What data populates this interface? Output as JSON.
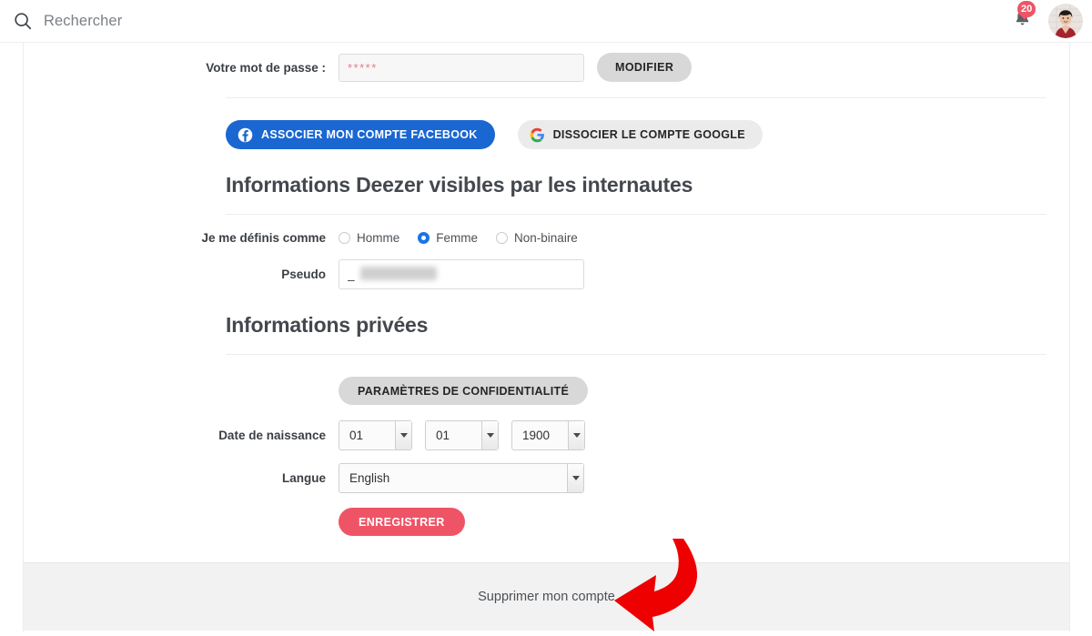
{
  "header": {
    "search": {
      "icon": "search-icon",
      "placeholder": "Rechercher",
      "value": ""
    },
    "notifications": {
      "icon": "bell-icon",
      "count": "20"
    },
    "avatar": {
      "icon": "avatar"
    }
  },
  "account": {
    "password": {
      "label": "Votre mot de passe :",
      "value": "*****",
      "modify_button": "MODIFIER"
    },
    "social": {
      "facebook_button": "ASSOCIER MON COMPTE FACEBOOK",
      "facebook_icon": "facebook-icon",
      "facebook_color": "#1a67d2",
      "google_button": "DISSOCIER LE COMPTE GOOGLE",
      "google_icon": "google-icon",
      "google_color": "#ebebeb"
    }
  },
  "public_info": {
    "title": "Informations Deezer visibles par les internautes",
    "gender": {
      "label": "Je me définis comme",
      "options": [
        {
          "label": "Homme",
          "selected": false
        },
        {
          "label": "Femme",
          "selected": true
        },
        {
          "label": "Non-binaire",
          "selected": false
        }
      ],
      "selected_color": "#1a73e8"
    },
    "pseudo": {
      "label": "Pseudo",
      "value": "_",
      "redacted": true
    }
  },
  "private_info": {
    "title": "Informations privées",
    "privacy_button": "PARAMÈTRES DE CONFIDENTIALITÉ",
    "birthdate": {
      "label": "Date de naissance",
      "day": "01",
      "month": "01",
      "year": "1900"
    },
    "language": {
      "label": "Langue",
      "value": "English"
    },
    "save_button": "ENREGISTRER",
    "save_color": "#ef5466"
  },
  "footer": {
    "delete_account_link": "Supprimer mon compte",
    "annotation": {
      "icon": "curved-arrow-annotation",
      "color": "#ee0000"
    }
  }
}
